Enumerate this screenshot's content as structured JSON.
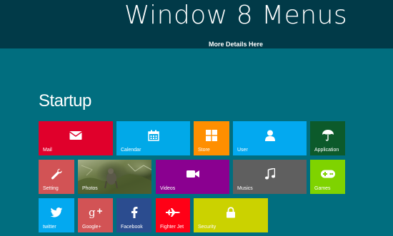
{
  "header": {
    "title": "Window 8 Menus",
    "details_link": "More Details Here"
  },
  "section": {
    "title": "Startup"
  },
  "tiles": {
    "mail": {
      "label": "Mail",
      "color": "#e0002b",
      "icon": "envelope-icon"
    },
    "calendar": {
      "label": "Calendar",
      "color": "#01a9e8",
      "icon": "calendar-icon"
    },
    "store": {
      "label": "Store",
      "color": "#ff8f00",
      "icon": "windows-logo-icon"
    },
    "user": {
      "label": "User",
      "color": "#03a9f0",
      "icon": "user-icon"
    },
    "application": {
      "label": "Application",
      "color": "#0c5a2b",
      "icon": "umbrella-icon"
    },
    "setting": {
      "label": "Setting",
      "color": "#d25355",
      "icon": "wrench-icon"
    },
    "photos": {
      "label": "Photos",
      "icon": "photo-thumbnail"
    },
    "videos": {
      "label": "Videos",
      "color": "#8a0090",
      "icon": "video-camera-icon"
    },
    "musics": {
      "label": "Musics",
      "color": "#5f5f5f",
      "icon": "music-note-icon"
    },
    "games": {
      "label": "Games",
      "color": "#7fd300",
      "icon": "gamepad-icon"
    },
    "twitter": {
      "label": "twitter",
      "color": "#03a9f0",
      "icon": "twitter-bird-icon"
    },
    "googleplus": {
      "label": "Google+",
      "color": "#d25355",
      "icon": "google-plus-icon"
    },
    "facebook": {
      "label": "Facebook",
      "color": "#2b4c8f",
      "icon": "facebook-icon"
    },
    "fighterjet": {
      "label": "Fighter Jet",
      "color": "#ff0016",
      "icon": "fighter-jet-icon"
    },
    "security": {
      "label": "Security",
      "color": "#cbd200",
      "icon": "lock-icon"
    }
  }
}
